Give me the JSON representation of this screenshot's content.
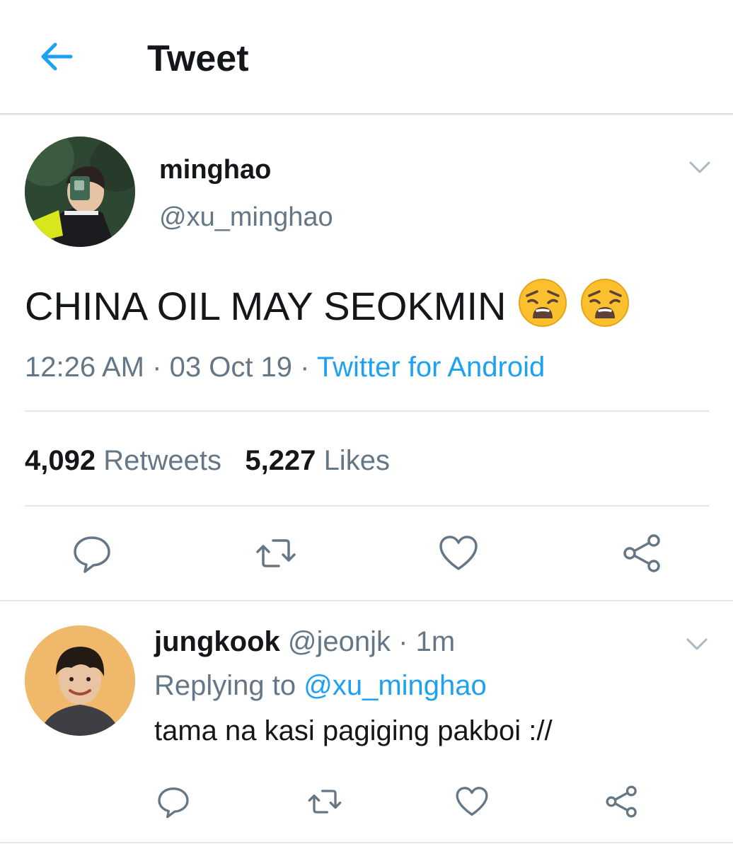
{
  "header": {
    "title": "Tweet"
  },
  "tweet": {
    "display_name": "minghao",
    "handle": "@xu_minghao",
    "text": "CHINA OIL MAY SEOKMIN",
    "emoji": "weary-face-emoji",
    "time": "12:26 AM",
    "separator": "·",
    "date": "03 Oct 19",
    "source": "Twitter for Android",
    "retweet_count": "4,092",
    "retweet_label": "Retweets",
    "like_count": "5,227",
    "like_label": "Likes",
    "actions": [
      "reply-icon",
      "retweet-icon",
      "like-icon",
      "share-icon"
    ]
  },
  "reply": {
    "display_name": "jungkook",
    "handle": "@jeonjk",
    "separator": "·",
    "age": "1m",
    "replying_label": "Replying to",
    "replying_to": "@xu_minghao",
    "text": "tama na kasi pagiging pakboi ://",
    "actions": [
      "reply-icon",
      "retweet-icon",
      "like-icon",
      "share-icon"
    ]
  },
  "colors": {
    "accent": "#1da1f2",
    "secondary_text": "#657786",
    "primary_text": "#14171a",
    "divider": "#e1e8ed"
  }
}
